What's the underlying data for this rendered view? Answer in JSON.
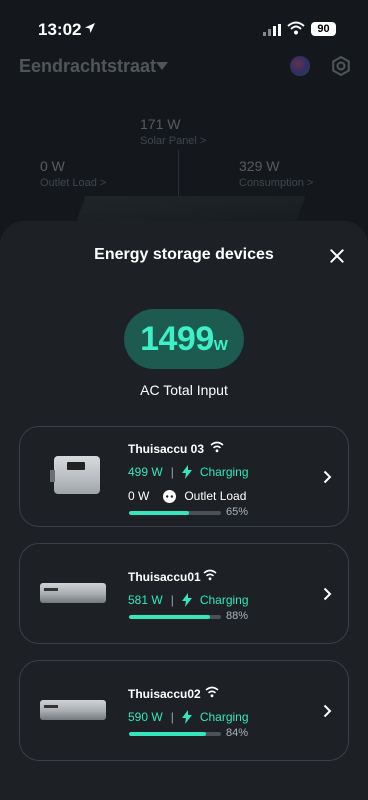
{
  "status": {
    "time": "13:02",
    "battery": "90"
  },
  "home": {
    "location": "Eendrachtstraat",
    "solar": {
      "value": "171 W",
      "label": "Solar Panel >"
    },
    "outlet": {
      "value": "0 W",
      "label": "Outlet Load >"
    },
    "consumption": {
      "value": "329 W",
      "label": "Consumption >"
    }
  },
  "sheet": {
    "title": "Energy storage devices",
    "total_value": "1499",
    "total_unit": "W",
    "total_label": "AC Total Input"
  },
  "devices": [
    {
      "name": "Thuisaccu 03",
      "power": "499 W",
      "status": "Charging",
      "outlet_power": "0 W",
      "outlet_label": "Outlet Load",
      "percent_label": "65%",
      "level": 0.65
    },
    {
      "name": "Thuisaccu01",
      "power": "581 W",
      "status": "Charging",
      "percent_label": "88%",
      "level": 0.88
    },
    {
      "name": "Thuisaccu02",
      "power": "590 W",
      "status": "Charging",
      "percent_label": "84%",
      "level": 0.84
    }
  ],
  "colors": {
    "accent": "#33e6bd",
    "pill_bg": "#1d5a4f",
    "card_border": "#3a4047"
  }
}
